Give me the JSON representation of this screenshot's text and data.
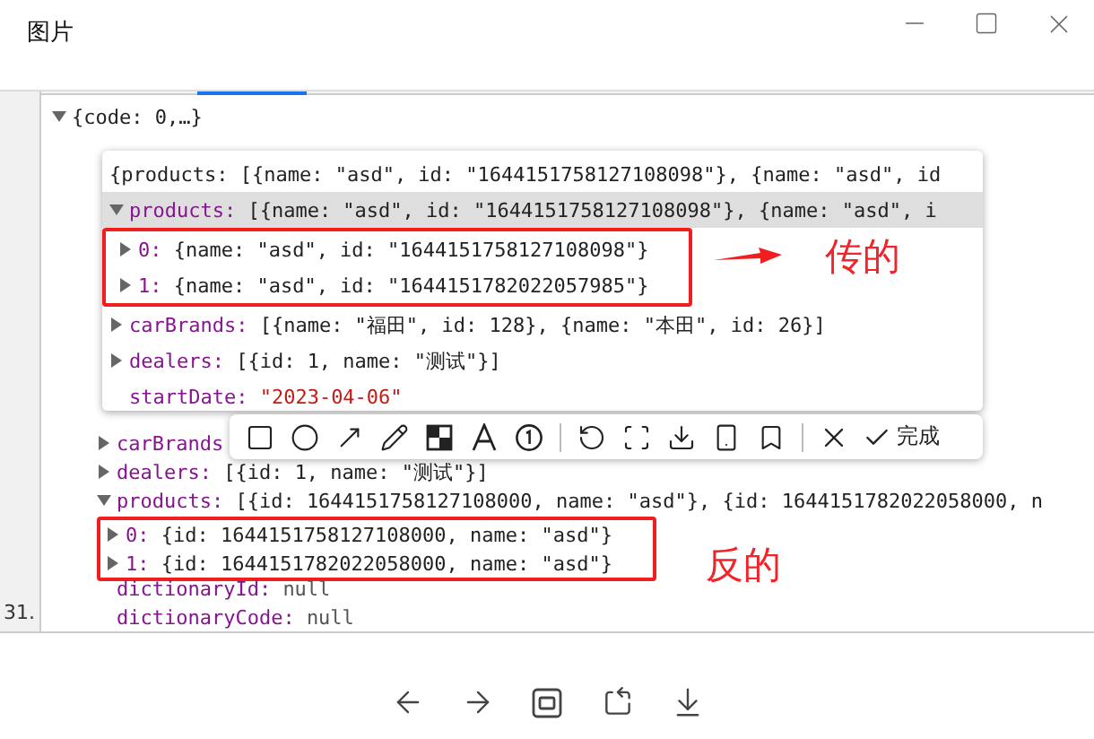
{
  "window": {
    "title": "图片"
  },
  "devtools": {
    "gutter_label": "31.",
    "tree": [
      {
        "value": "{code: 0,…}",
        "kind": "preview",
        "expanded": true,
        "children": [
          {
            "key": "carBrands",
            "expanded": false
          },
          {
            "key": "dealers:",
            "value": "[{id: 1, name: \"测试\"}]",
            "kind": "preview",
            "expanded": false
          },
          {
            "key": "products:",
            "value": "[{id: 1644151758127108000, name: \"asd\"}, {id: 1644151782022058000, n",
            "kind": "preview",
            "expanded": true,
            "annotation": {
              "text": "反的",
              "arrow": false
            },
            "children": [
              {
                "key": "0:",
                "value": "{id: 1644151758127108000, name: \"asd\"}",
                "kind": "preview",
                "expanded": false
              },
              {
                "key": "1:",
                "value": "{id: 1644151782022058000, name: \"asd\"}",
                "kind": "preview",
                "expanded": false
              }
            ]
          },
          {
            "key": "dictionaryId:",
            "value": "null",
            "kind": "null"
          },
          {
            "key": "dictionaryCode:",
            "value": "null",
            "kind": "null"
          }
        ]
      }
    ]
  },
  "popup": {
    "summary": "{products: [{name: \"asd\", id: \"1644151758127108098\"}, {name: \"asd\", id",
    "lines": [
      {
        "key": "products:",
        "value": "[{name: \"asd\", id: \"1644151758127108098\"}, {name: \"asd\", i",
        "kind": "preview",
        "expanded": true,
        "selected": true,
        "annotation": {
          "text": "传的",
          "arrow": true
        },
        "children": [
          {
            "key": "0:",
            "value": "{name: \"asd\", id: \"1644151758127108098\"}",
            "kind": "preview",
            "expanded": false,
            "selected": false
          },
          {
            "key": "1:",
            "value": "{name: \"asd\", id: \"1644151782022057985\"}",
            "kind": "preview",
            "expanded": false,
            "selected": false
          }
        ]
      },
      {
        "key": "carBrands:",
        "value": "[{name: \"福田\", id: 128}, {name: \"本田\", id: 26}]",
        "kind": "preview",
        "expanded": false,
        "selected": false
      },
      {
        "key": "dealers:",
        "value": "[{id: 1, name: \"测试\"}]",
        "kind": "preview",
        "expanded": false,
        "selected": false
      },
      {
        "key": "startDate:",
        "value": "\"2023-04-06\"",
        "kind": "string",
        "selected": false
      }
    ]
  },
  "markup_toolbar": {
    "done_label": "完成"
  }
}
